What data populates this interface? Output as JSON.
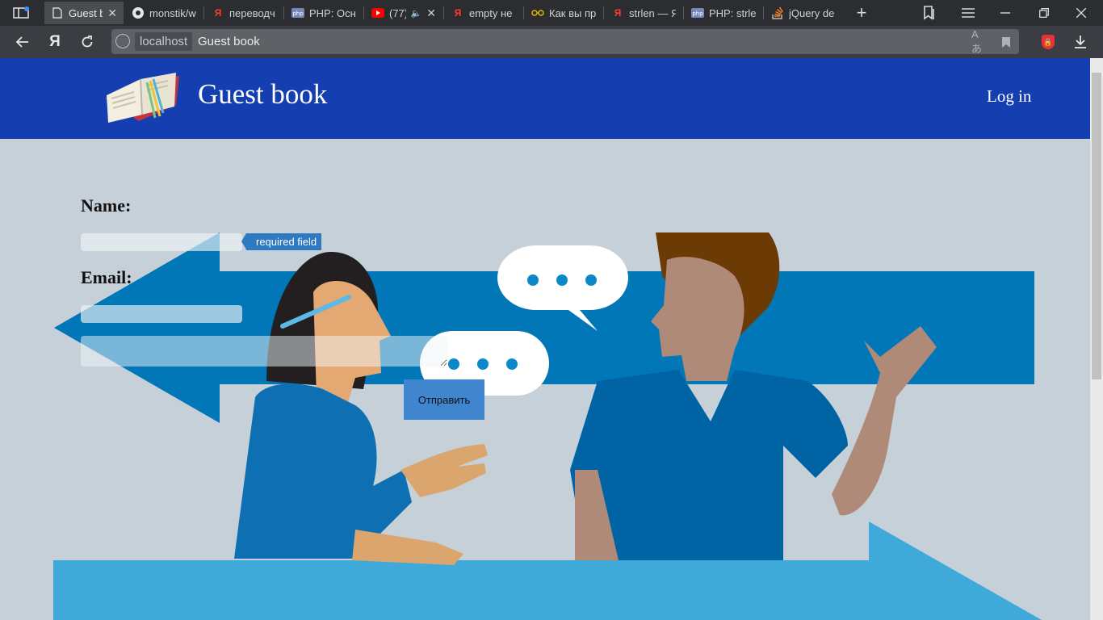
{
  "browser": {
    "tabs": [
      {
        "label": "Guest b",
        "icon": "page-icon",
        "active": true
      },
      {
        "label": "monstik/w",
        "icon": "github-icon"
      },
      {
        "label": "переводч",
        "icon": "yandex-icon"
      },
      {
        "label": "PHP: Осн",
        "icon": "php-icon"
      },
      {
        "label": "(77)",
        "icon": "youtube-icon"
      },
      {
        "label": "empty не",
        "icon": "yandex-icon"
      },
      {
        "label": "Как вы пр",
        "icon": "glasses-icon"
      },
      {
        "label": "strlen — Я",
        "icon": "yandex-icon"
      },
      {
        "label": "PHP: strle",
        "icon": "php-icon"
      },
      {
        "label": "jQuery de",
        "icon": "stackoverflow-icon"
      }
    ],
    "address": {
      "host": "localhost",
      "title": "Guest book"
    },
    "colors": {
      "tabbar": "#2b2d31",
      "toolbar": "#3b3d42"
    }
  },
  "header": {
    "title": "Guest book",
    "login_label": "Log in",
    "background": "#153fb0"
  },
  "form": {
    "name_label": "Name:",
    "required_badge": "required field",
    "email_label": "Email:",
    "submit_label": "Отправить"
  }
}
